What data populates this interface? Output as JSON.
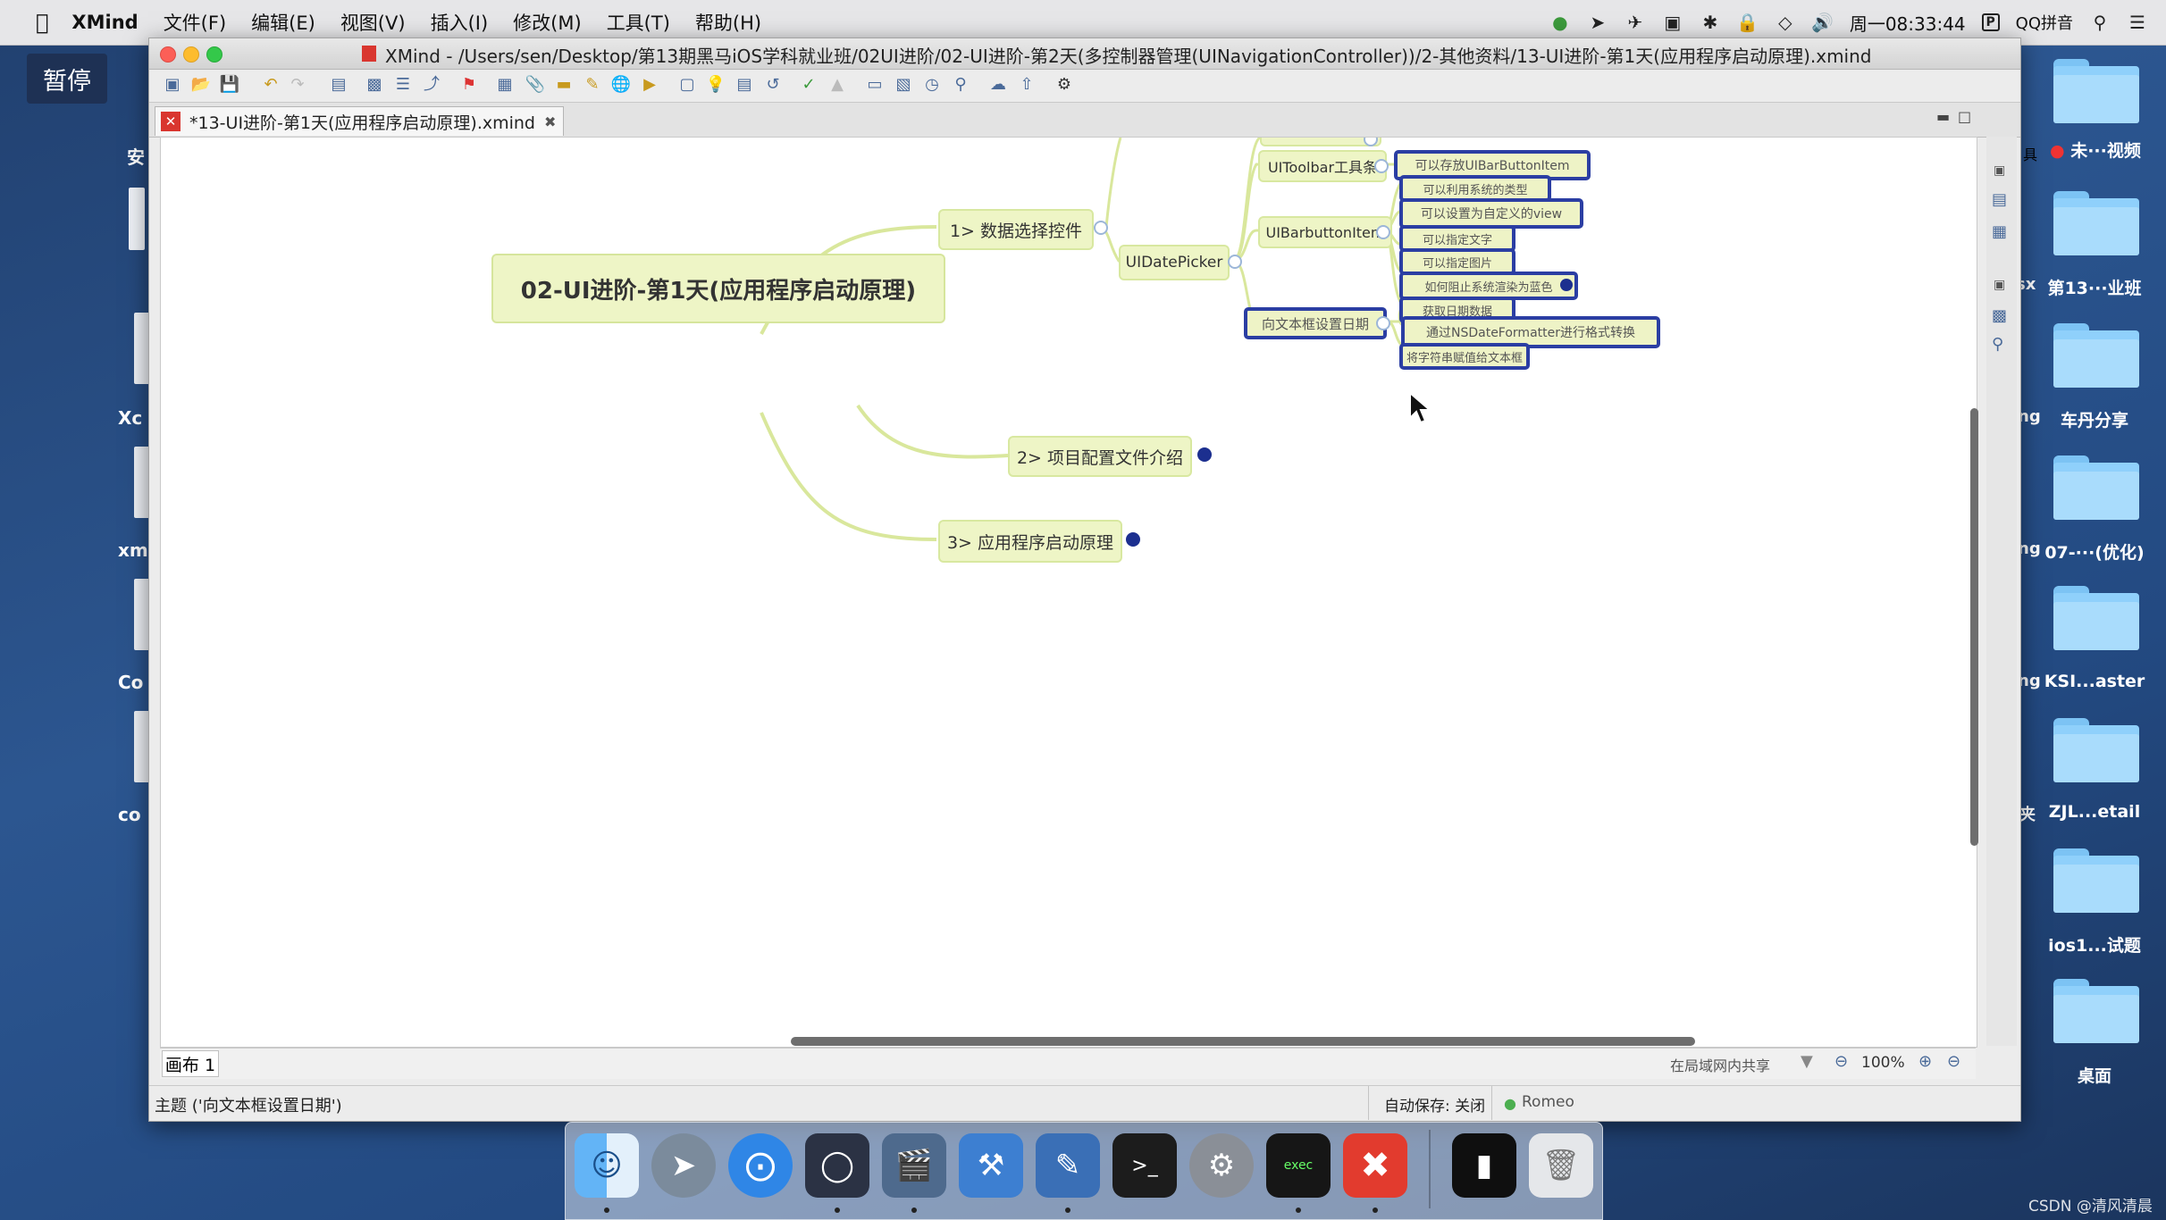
{
  "menubar": {
    "app": "XMind",
    "items": [
      "文件(F)",
      "编辑(E)",
      "视图(V)",
      "插入(I)",
      "修改(M)",
      "工具(T)",
      "帮助(H)"
    ],
    "clock": "周一08:33:44",
    "input_method": "QQ拼音"
  },
  "overlay": {
    "pause": "暂停"
  },
  "desktop_left_labels": [
    "安",
    "Xc",
    "xm",
    "Co",
    "co"
  ],
  "desktop_right": {
    "folders": [
      "第13···业班",
      "车丹分享",
      "07-···(优化)",
      "KSI...aster",
      "ZJL...etail",
      "ios1...试题",
      "桌面"
    ],
    "video_label": "未···视频",
    "partial_labels": [
      "具",
      "sx",
      "ng",
      "ng",
      "ng",
      "夹"
    ]
  },
  "window": {
    "title": "XMind - /Users/sen/Desktop/第13期黑马iOS学科就业班/02UI进阶/02-UI进阶-第2天(多控制器管理(UINavigationController))/2-其他资料/13-UI进阶-第1天(应用程序启动原理).xmind",
    "tab_label": "*13-UI进阶-第1天(应用程序启动原理).xmind",
    "sheet_tab": "画布 1",
    "status_left": "主题 ('向文本框设置日期')",
    "autosave": "自动保存: 关闭",
    "user": "Romeo",
    "share_label": "在局域网内共享",
    "zoom": "100%"
  },
  "mindmap": {
    "central": "02-UI进阶-第1天(应用程序启动原理)",
    "branch1": "1> 数据选择控件",
    "branch2": "2> 项目配置文件介绍",
    "branch3": "3> 应用程序启动原理",
    "datepicker": "UIDatePicker",
    "toolbar": "UIToolbar工具条",
    "barbutton": "UIBarbuttonItem",
    "setdate": "向文本框设置日期",
    "leaves": [
      "可以存放UIBarButtonItem",
      "可以利用系统的类型",
      "可以设置为自定义的view",
      "可以指定文字",
      "可以指定图片",
      "如何阻止系统渲染为蓝色",
      "获取日期数据",
      "通过NSDateFormatter进行格式转换",
      "将字符串赋值给文本框"
    ]
  },
  "dock": {
    "apps": [
      "finder-icon",
      "launchpad-icon",
      "safari-icon",
      "mouse-icon",
      "video-editor-icon",
      "xcode-icon",
      "instruments-icon",
      "terminal-icon",
      "system-preferences-icon",
      "console-icon",
      "xmind-icon",
      "preview-icon",
      "trash-icon"
    ]
  },
  "watermark": "CSDN @清风清晨",
  "colors": {
    "topic_fill": "#eef5c6",
    "selection_border": "#2b3ea3",
    "branch_line": "#d9e79c",
    "dot": "#1c2f8f"
  }
}
